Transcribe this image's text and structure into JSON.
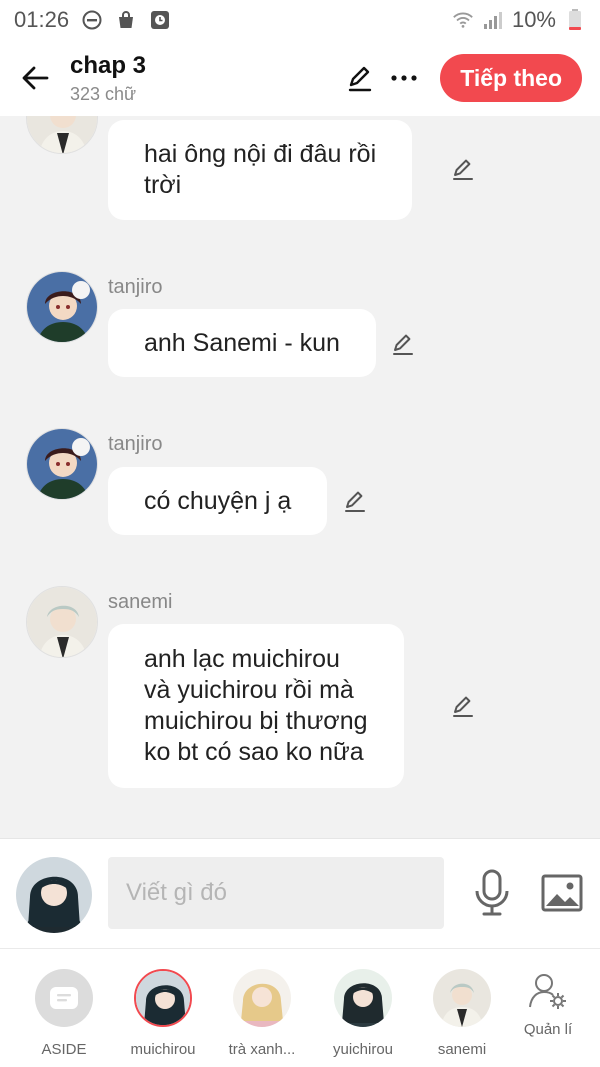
{
  "status": {
    "time": "01:26",
    "battery": "10%"
  },
  "header": {
    "title": "chap 3",
    "word_count": "323 chữ",
    "next_label": "Tiếp theo"
  },
  "messages": [
    {
      "sender": "",
      "text": "hai ông nội đi đâu rồi\ntrời"
    },
    {
      "sender": "tanjiro",
      "text": "anh Sanemi - kun"
    },
    {
      "sender": "tanjiro",
      "text": "có chuyện j ạ"
    },
    {
      "sender": "sanemi",
      "text": "anh lạc muichirou\nvà yuichirou rồi mà\nmuichirou bị thương\nko bt có sao ko nữa"
    }
  ],
  "composer": {
    "placeholder": "Viết gì đó"
  },
  "characters": [
    {
      "label": "ASIDE"
    },
    {
      "label": "muichirou"
    },
    {
      "label": "trà xanh..."
    },
    {
      "label": "yuichirou"
    },
    {
      "label": "sanemi"
    },
    {
      "label": "Quản lí"
    }
  ],
  "colors": {
    "accent": "#f2494f",
    "background": "#f2f2f2",
    "bubble": "#ffffff"
  },
  "icons": [
    "back-arrow-icon",
    "pencil-icon",
    "more-icon",
    "mic-icon",
    "image-icon",
    "manage-user-icon"
  ]
}
